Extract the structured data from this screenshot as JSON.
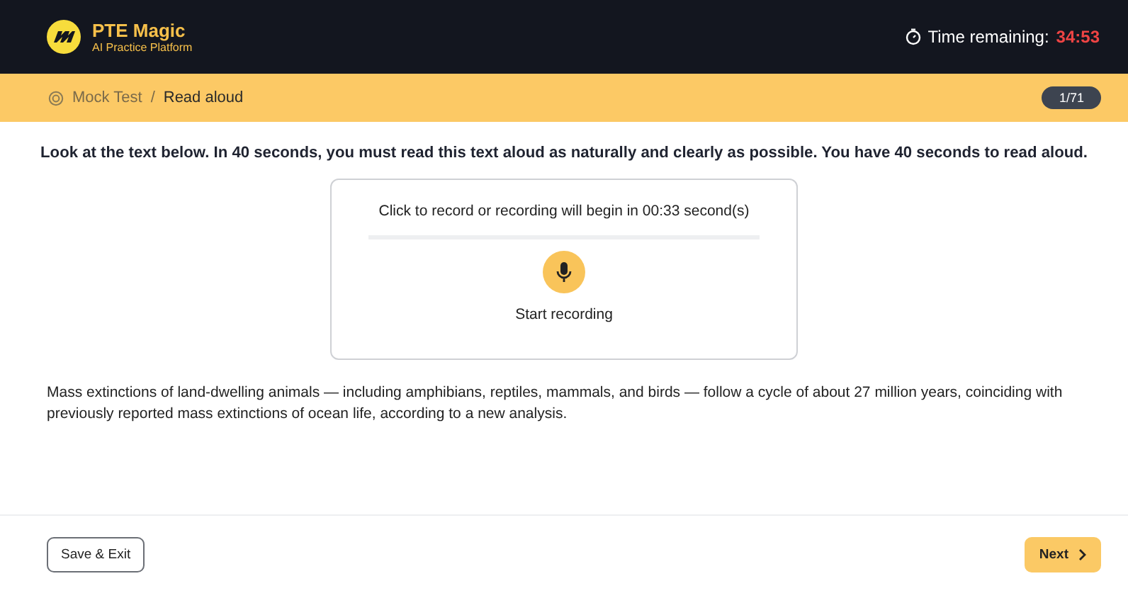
{
  "brand": {
    "name": "PTE Magic",
    "tagline": "AI Practice Platform"
  },
  "timer": {
    "label": "Time remaining:",
    "value": "34:53"
  },
  "breadcrumb": [
    "Mock Test",
    "Read aloud"
  ],
  "breadcrumb_separator": "/",
  "progress": "1/71",
  "instruction": "Look at the text below. In 40 seconds, you must read this text aloud as naturally and clearly as possible. You have 40 seconds to read aloud.",
  "recorder": {
    "status": "Click to record or recording will begin in 00:33 second(s)",
    "action": "Start recording"
  },
  "passage": "Mass extinctions of land-dwelling animals — including amphibians, reptiles, mammals, and birds — follow a cycle of about 27 million years, coinciding with previously reported mass extinctions of ocean life, according to a new analysis.",
  "buttons": {
    "exit": "Save & Exit",
    "next": "Next"
  }
}
